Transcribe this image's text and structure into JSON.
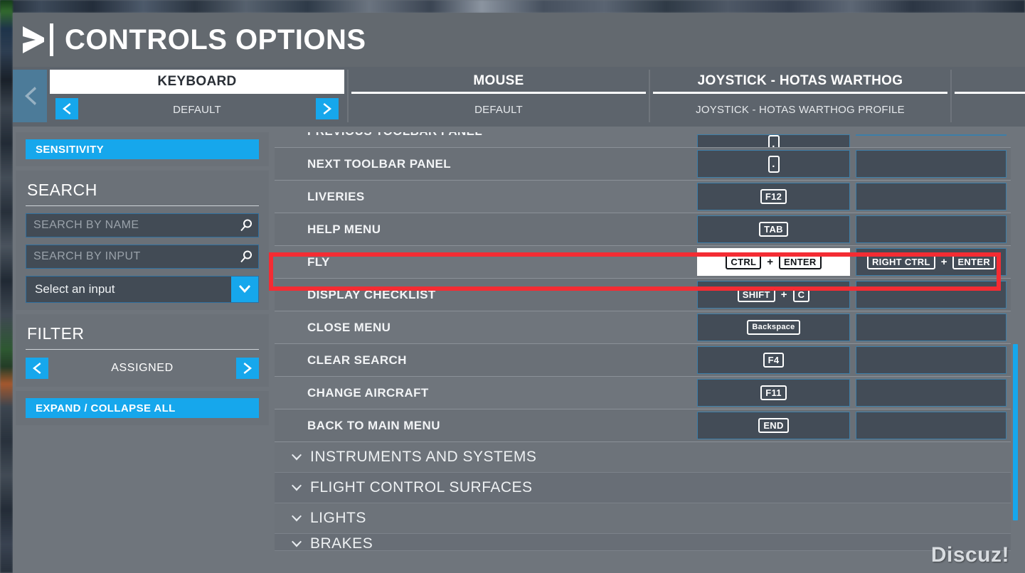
{
  "header": {
    "title": "CONTROLS OPTIONS",
    "chevron_icon": "chevron-right-icon"
  },
  "tabbar": {
    "scroll_left_icon": "chevron-left-icon",
    "prev_icon": "chevron-left-icon",
    "next_icon": "chevron-right-icon",
    "tabs": [
      {
        "name": "KEYBOARD",
        "profile": "DEFAULT",
        "active": true,
        "has_profile_arrows": true
      },
      {
        "name": "MOUSE",
        "profile": "DEFAULT",
        "active": false,
        "has_profile_arrows": false
      },
      {
        "name": "JOYSTICK - HOTAS WARTHOG",
        "profile": "JOYSTICK - HOTAS WARTHOG PROFILE",
        "active": false,
        "has_profile_arrows": false
      },
      {
        "name": "",
        "profile": "",
        "active": false,
        "has_profile_arrows": false
      }
    ]
  },
  "sidebar": {
    "sensitivity_label": "SENSITIVITY",
    "search": {
      "title": "SEARCH",
      "by_name_placeholder": "SEARCH BY NAME",
      "by_name_value": "",
      "by_input_placeholder": "SEARCH BY INPUT",
      "by_input_value": "",
      "select_value": "Select an input",
      "search_icon": "magnifier-icon",
      "caret_icon": "chevron-down-icon"
    },
    "filter": {
      "title": "FILTER",
      "value": "ASSIGNED",
      "prev_icon": "chevron-left-icon",
      "next_icon": "chevron-right-icon"
    },
    "expand_collapse_label": "EXPAND / COLLAPSE ALL"
  },
  "table": {
    "rows": [
      {
        "name": "PREVIOUS TOOLBAR PANEL",
        "clipped": true,
        "primary": [
          {
            "type": "dot",
            "label": "."
          }
        ],
        "secondary": []
      },
      {
        "name": "NEXT TOOLBAR PANEL",
        "primary": [
          {
            "type": "dot",
            "label": "."
          }
        ],
        "secondary": []
      },
      {
        "name": "LIVERIES",
        "primary": [
          {
            "type": "key",
            "label": "F12"
          }
        ],
        "secondary": []
      },
      {
        "name": "HELP MENU",
        "primary": [
          {
            "type": "key",
            "label": "TAB"
          }
        ],
        "secondary": []
      },
      {
        "name": "FLY",
        "selected": true,
        "primary": [
          {
            "type": "key",
            "label": "CTRL"
          },
          {
            "type": "plus",
            "label": "+"
          },
          {
            "type": "key",
            "label": "ENTER"
          }
        ],
        "secondary": [
          {
            "type": "key",
            "label": "RIGHT CTRL"
          },
          {
            "type": "plus",
            "label": "+"
          },
          {
            "type": "key",
            "label": "ENTER"
          }
        ]
      },
      {
        "name": "DISPLAY CHECKLIST",
        "primary": [
          {
            "type": "key",
            "label": "SHIFT"
          },
          {
            "type": "plus",
            "label": "+"
          },
          {
            "type": "key",
            "label": "C"
          }
        ],
        "secondary": []
      },
      {
        "name": "CLOSE MENU",
        "primary": [
          {
            "type": "keysmall",
            "label": "Backspace"
          }
        ],
        "secondary": []
      },
      {
        "name": "CLEAR SEARCH",
        "primary": [
          {
            "type": "key",
            "label": "F4"
          }
        ],
        "secondary": []
      },
      {
        "name": "CHANGE AIRCRAFT",
        "primary": [
          {
            "type": "key",
            "label": "F11"
          }
        ],
        "secondary": []
      },
      {
        "name": "BACK TO MAIN MENU",
        "primary": [
          {
            "type": "key",
            "label": "END"
          }
        ],
        "secondary": []
      }
    ],
    "categories": [
      {
        "label": "INSTRUMENTS AND SYSTEMS",
        "caret_icon": "chevron-down-icon",
        "clipped": false
      },
      {
        "label": "FLIGHT CONTROL SURFACES",
        "caret_icon": "chevron-down-icon",
        "clipped": false
      },
      {
        "label": "LIGHTS",
        "caret_icon": "chevron-down-icon",
        "clipped": false
      },
      {
        "label": "BRAKES",
        "caret_icon": "chevron-down-icon",
        "clipped": true
      }
    ]
  },
  "scrollbar": {
    "thumb_top_pct": 48,
    "thumb_height_pct": 40
  },
  "annotation": {
    "target_row": "FLY",
    "color": "#f42c33"
  },
  "watermark": {
    "text": "Discuz!"
  },
  "colors": {
    "accent_blue": "#16a7ec",
    "panel": "#6b7178",
    "window": "#6f757c",
    "header": "#63696f",
    "cell": "#434c57",
    "cell_border": "#3d7ea8",
    "annotation_red": "#f42c33"
  }
}
